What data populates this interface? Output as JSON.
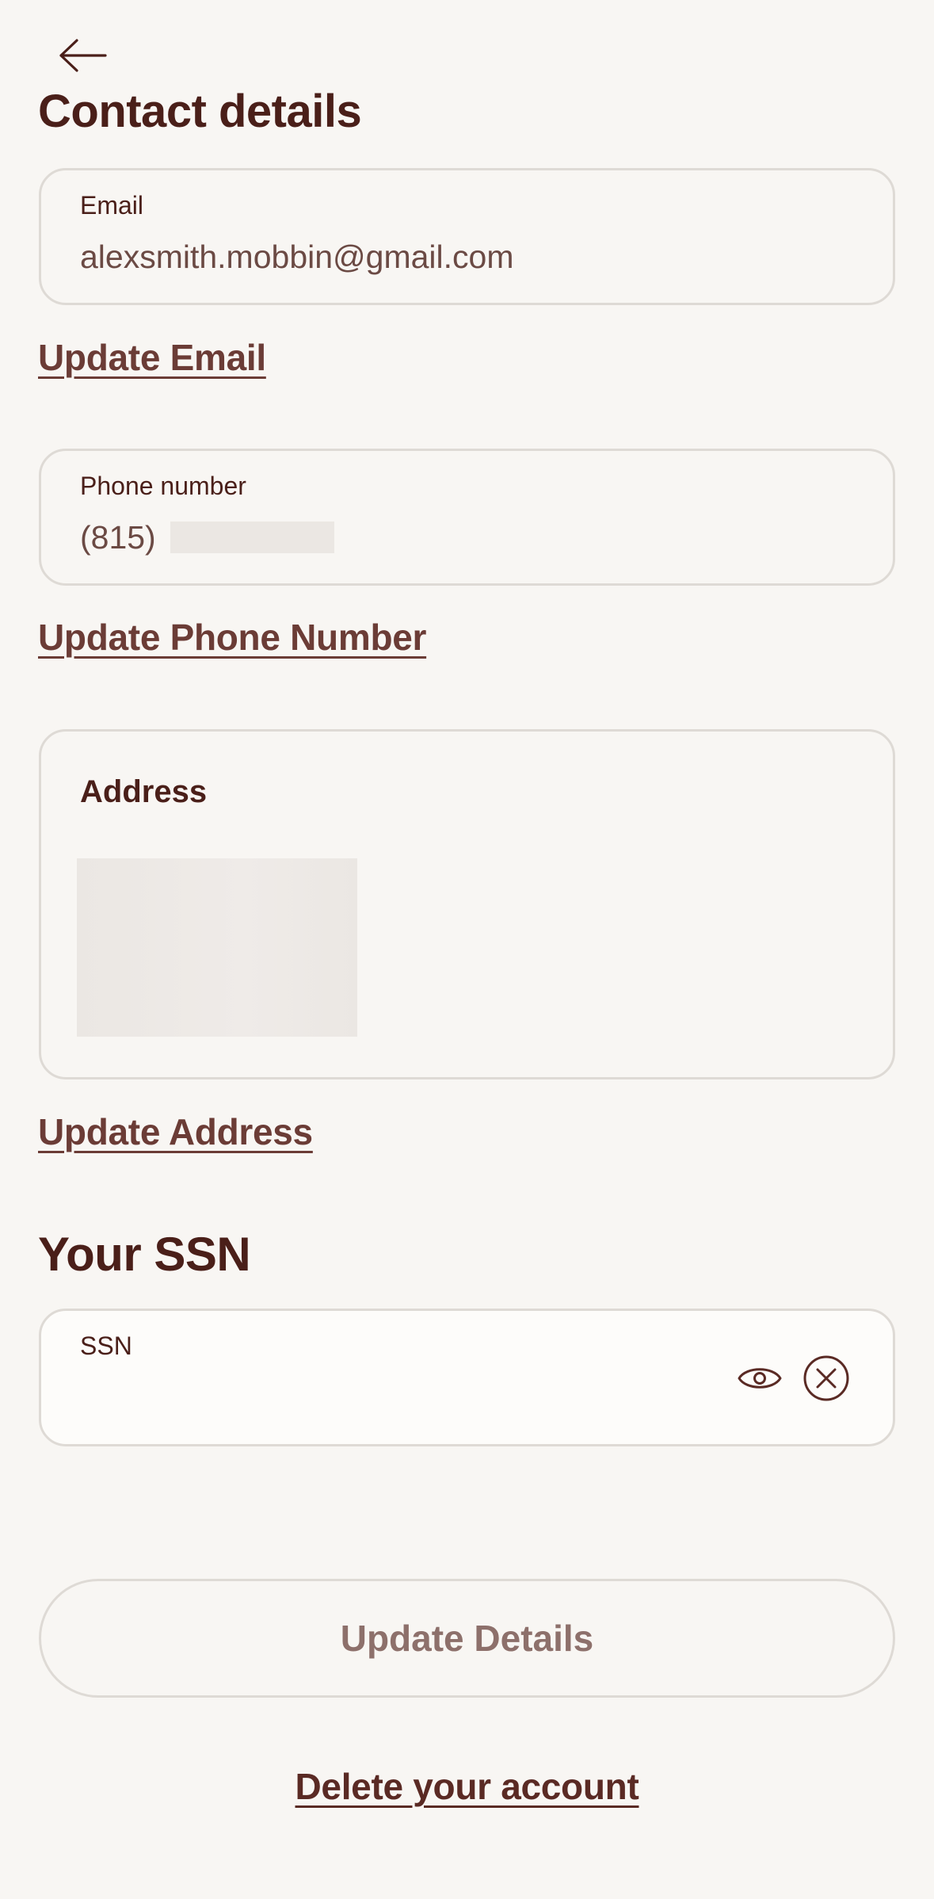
{
  "header": {
    "back_icon": "arrow-left-icon",
    "contact_title": "Contact details"
  },
  "email": {
    "label": "Email",
    "value": "alexsmith.mobbin@gmail.com",
    "update_link": "Update Email"
  },
  "phone": {
    "label": "Phone number",
    "value": "(815)",
    "update_link": "Update Phone Number"
  },
  "address": {
    "label": "Address",
    "update_link": "Update Address"
  },
  "ssn": {
    "section_title": "Your SSN",
    "label": "SSN",
    "value": "",
    "show_icon": "eye-icon",
    "clear_icon": "close-circle-icon"
  },
  "actions": {
    "update_details": "Update Details",
    "delete_account": "Delete your account"
  },
  "colors": {
    "background": "#f8f6f3",
    "text_primary": "#4a1f19",
    "link": "#6b3c36",
    "border": "#dedad5",
    "button_disabled_text": "#8d706b"
  }
}
